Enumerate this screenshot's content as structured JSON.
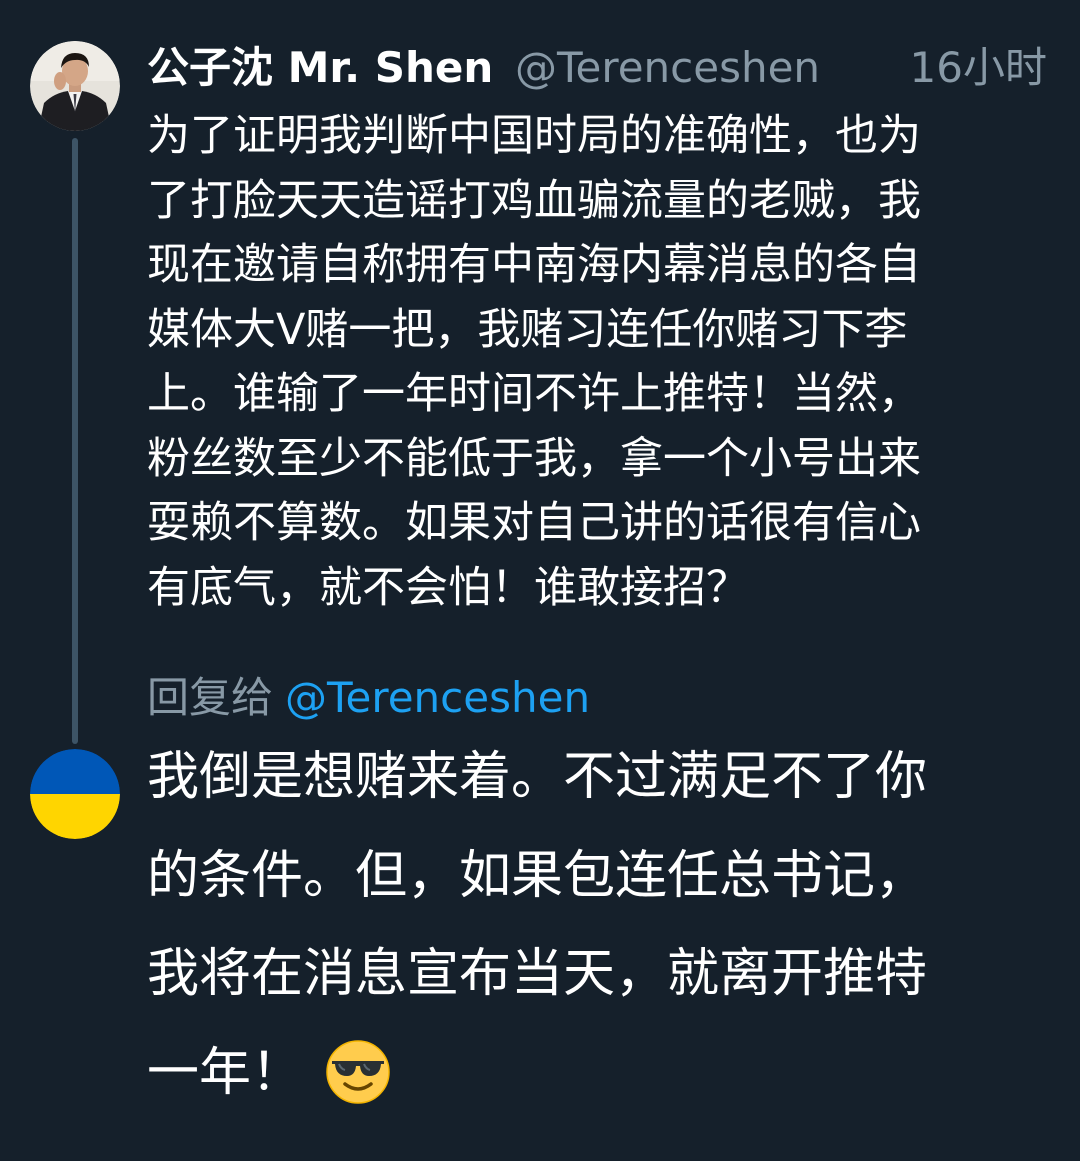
{
  "tweet": {
    "display_name": "公子沈 Mr. Shen",
    "handle": "@Terenceshen",
    "time": "16小时",
    "body_lines": [
      "为了证明我判断中国时局的准确性，也为",
      "了打脸天天造谣打鸡血骗流量的老贼，我",
      "现在邀请自称拥有中南海内幕消息的各自",
      "媒体大V赌一把，我赌习连任你赌习下李",
      "上。谁输了一年时间不许上推特！当然，",
      "粉丝数至少不能低于我，拿一个小号出来",
      "耍赖不算数。如果对自己讲的话很有信心",
      "有底气，就不会怕！谁敢接招？"
    ],
    "avatar_icon": "profile-photo"
  },
  "reply": {
    "reply_prefix": "回复给",
    "reply_handle": "@Terenceshen",
    "body_lines": [
      "我倒是想赌来着。不过满足不了你",
      "的条件。但，如果包连任总书记，",
      "我将在消息宣布当天，就离开推特",
      "一年！"
    ],
    "emoji_icon": "smiling-face-with-sunglasses-icon",
    "avatar_icon": "ukraine-flag-avatar",
    "avatar_colors": {
      "top": "#0057b7",
      "bottom": "#ffd500"
    }
  },
  "colors": {
    "background": "#15202b",
    "secondary_text": "#8899a6",
    "link": "#1da1f2",
    "thread_line": "#3d5466"
  }
}
